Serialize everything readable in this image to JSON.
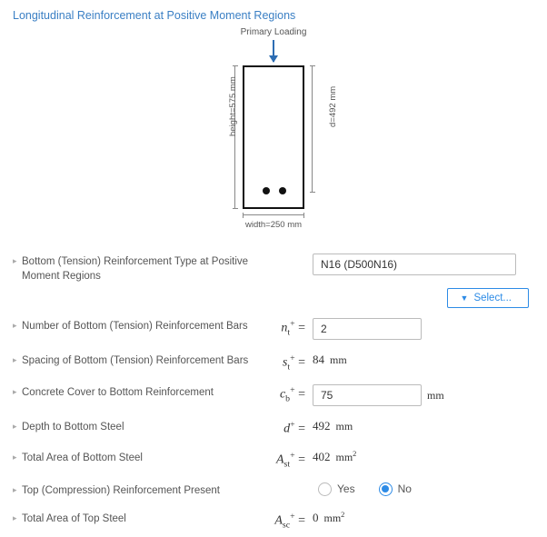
{
  "section_title": "Longitudinal Reinforcement at Positive Moment Regions",
  "diagram": {
    "primary_loading": "Primary Loading",
    "height_label": "height=575 mm",
    "d_label": "d=492 mm",
    "width_label": "width=250 mm"
  },
  "rows": {
    "reinf_type": {
      "label": "Bottom (Tension) Reinforcement Type at Positive Moment Regions",
      "value": "N16 (D500N16)"
    },
    "select_button": "Select...",
    "num_bars": {
      "label": "Number of Bottom (Tension) Reinforcement Bars",
      "symbol_html": "<span class='var'>n</span><sub>t</sub><sup>+</sup> =",
      "value": "2"
    },
    "spacing": {
      "label": "Spacing of Bottom (Tension) Reinforcement Bars",
      "symbol_html": "<span class='var'>s</span><sub>t</sub><sup>+</sup> =",
      "value": "84",
      "unit": "mm"
    },
    "cover": {
      "label": "Concrete Cover to Bottom Reinforcement",
      "symbol_html": "<span class='var'>c</span><sub>b</sub><sup>+</sup> =",
      "value": "75",
      "unit": "mm"
    },
    "depth": {
      "label": "Depth to Bottom Steel",
      "symbol_html": "<span class='var'>d</span><sup>+</sup> =",
      "value": "492",
      "unit": "mm"
    },
    "area_bot": {
      "label": "Total Area of Bottom Steel",
      "symbol_html": "<span class='var'>A</span><sub>st</sub><sup>+</sup> =",
      "value": "402",
      "unit_html": "mm<sup>2</sup>"
    },
    "top_present": {
      "label": "Top (Compression) Reinforcement Present",
      "yes": "Yes",
      "no": "No",
      "selected": "no"
    },
    "area_top": {
      "label": "Total Area of Top Steel",
      "symbol_html": "<span class='var'>A</span><sub>sc</sub><sup>+</sup> =",
      "value": "0",
      "unit_html": "mm<sup>2</sup>"
    }
  },
  "icons": {
    "filter": "▼",
    "expand": "▸"
  }
}
